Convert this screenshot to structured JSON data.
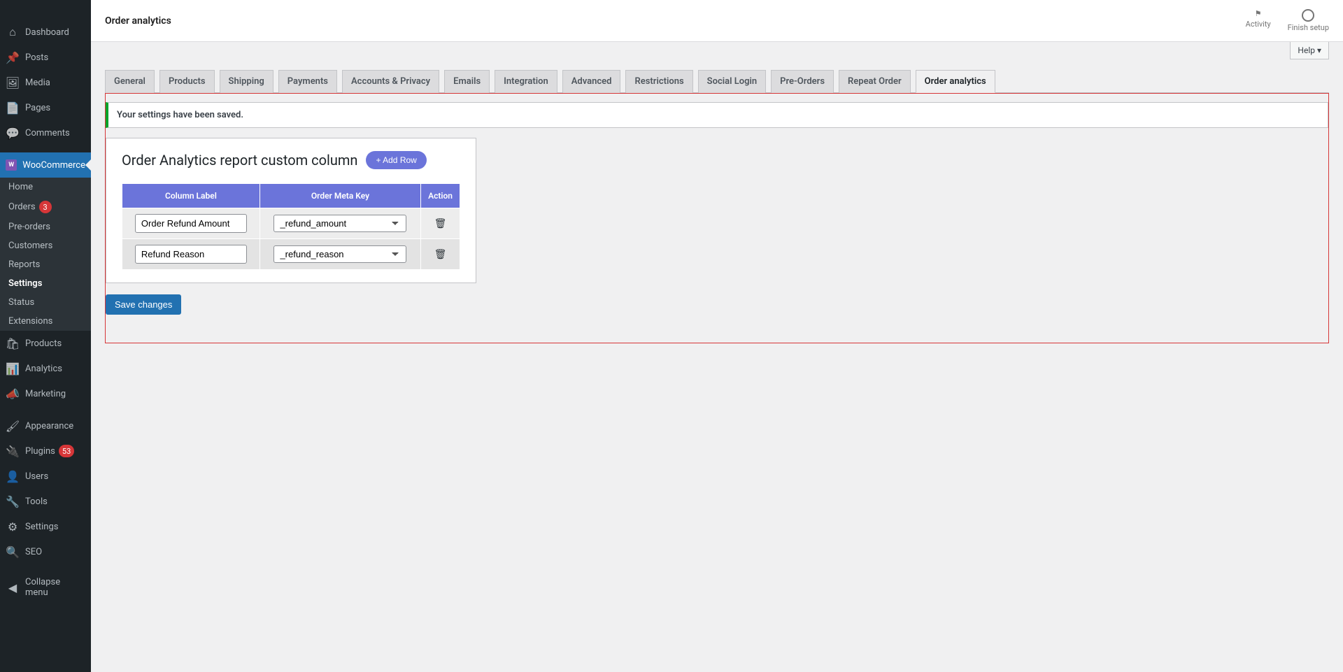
{
  "sidebar": {
    "items": [
      {
        "id": "dashboard",
        "label": "Dashboard",
        "icon": "⌂"
      },
      {
        "id": "posts",
        "label": "Posts",
        "icon": "📌"
      },
      {
        "id": "media",
        "label": "Media",
        "icon": "🖼"
      },
      {
        "id": "pages",
        "label": "Pages",
        "icon": "📄"
      },
      {
        "id": "comments",
        "label": "Comments",
        "icon": "💬"
      },
      {
        "id": "woocommerce",
        "label": "WooCommerce",
        "icon": "woo",
        "active": true
      },
      {
        "id": "products",
        "label": "Products",
        "icon": "🛍"
      },
      {
        "id": "analytics",
        "label": "Analytics",
        "icon": "📊"
      },
      {
        "id": "marketing",
        "label": "Marketing",
        "icon": "📣"
      },
      {
        "id": "appearance",
        "label": "Appearance",
        "icon": "🖌"
      },
      {
        "id": "plugins",
        "label": "Plugins",
        "icon": "🔌",
        "badge": "53"
      },
      {
        "id": "users",
        "label": "Users",
        "icon": "👤"
      },
      {
        "id": "tools",
        "label": "Tools",
        "icon": "🔧"
      },
      {
        "id": "settings",
        "label": "Settings",
        "icon": "⚙"
      },
      {
        "id": "seo",
        "label": "SEO",
        "icon": "🔍"
      },
      {
        "id": "collapse",
        "label": "Collapse menu",
        "icon": "◀"
      }
    ],
    "submenu": [
      {
        "id": "home",
        "label": "Home"
      },
      {
        "id": "orders",
        "label": "Orders",
        "badge": "3"
      },
      {
        "id": "preorders",
        "label": "Pre-orders"
      },
      {
        "id": "customers",
        "label": "Customers"
      },
      {
        "id": "reports",
        "label": "Reports"
      },
      {
        "id": "settings",
        "label": "Settings",
        "active": true
      },
      {
        "id": "status",
        "label": "Status"
      },
      {
        "id": "extensions",
        "label": "Extensions"
      }
    ]
  },
  "topbar": {
    "title": "Order analytics",
    "activity": "Activity",
    "finish_setup": "Finish setup"
  },
  "help_label": "Help ▾",
  "tabs": [
    {
      "label": "General"
    },
    {
      "label": "Products"
    },
    {
      "label": "Shipping"
    },
    {
      "label": "Payments"
    },
    {
      "label": "Accounts & Privacy"
    },
    {
      "label": "Emails"
    },
    {
      "label": "Integration"
    },
    {
      "label": "Advanced"
    },
    {
      "label": "Restrictions"
    },
    {
      "label": "Social Login"
    },
    {
      "label": "Pre-Orders"
    },
    {
      "label": "Repeat Order"
    },
    {
      "label": "Order analytics",
      "active": true
    }
  ],
  "notice": {
    "text": "Your settings have been saved."
  },
  "card": {
    "title": "Order Analytics report custom column",
    "add_row_label": "+ Add Row",
    "headers": {
      "label": "Column Label",
      "key": "Order Meta Key",
      "action": "Action"
    },
    "rows": [
      {
        "label": "Order Refund Amount",
        "key": "_refund_amount"
      },
      {
        "label": "Refund Reason",
        "key": "_refund_reason"
      }
    ]
  },
  "save_label": "Save changes"
}
